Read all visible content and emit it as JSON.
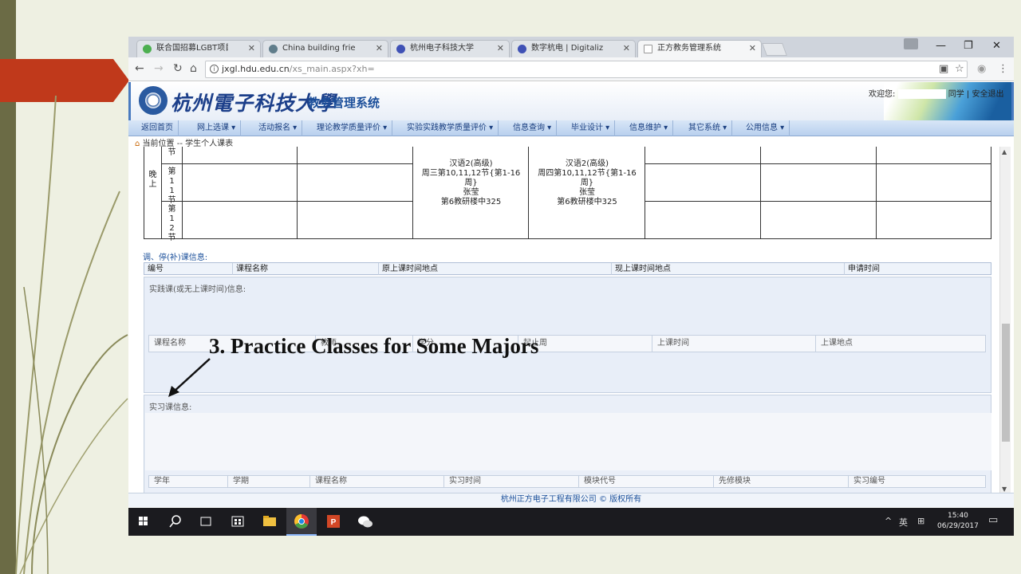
{
  "browser": {
    "tabs": [
      {
        "title": "联合国招募LGBT项目官员",
        "icon_color": "#4caf50"
      },
      {
        "title": "China building friendship",
        "icon_color": "#607d8b"
      },
      {
        "title": "杭州电子科技大学",
        "icon_color": "#3f51b5"
      },
      {
        "title": "数字杭电 | Digitalized DC",
        "icon_color": "#3f51b5"
      },
      {
        "title": "正方教务管理系统",
        "icon_color": "#9e9e9e"
      }
    ],
    "url_host": "jxgl.hdu.edu.cn",
    "url_path": "/xs_main.aspx?xh="
  },
  "site": {
    "school_name": "杭州電子科技大學",
    "system_name": "教务管理系统",
    "welcome_label": "欢迎您:",
    "welcome_suffix": "同学",
    "logout": "安全退出"
  },
  "menu": [
    "返回首页",
    "网上选课 ▾",
    "活动报名 ▾",
    "理论教学质量评价 ▾",
    "实验实践教学质量评价 ▾",
    "信息查询 ▾",
    "毕业设计 ▾",
    "信息维护 ▾",
    "其它系统 ▾",
    "公用信息 ▾"
  ],
  "breadcrumb": "当前位置 -- 学生个人课表",
  "timetable": {
    "period_label": "晚上",
    "rows": [
      "节",
      "第11节",
      "第12节"
    ],
    "courses": [
      {
        "name": "汉语2(高级)",
        "time": "周三第10,11,12节{第1-16周}",
        "teacher": "张莹",
        "room": "第6教研楼中325"
      },
      {
        "name": "汉语2(高级)",
        "time": "周四第10,11,12节{第1-16周}",
        "teacher": "张莹",
        "room": "第6教研楼中325"
      }
    ]
  },
  "adjustment": {
    "title": "调、停(补)课信息:",
    "headers": [
      "编号",
      "课程名称",
      "原上课时间地点",
      "现上课时间地点",
      "申请时间"
    ]
  },
  "practice": {
    "title": "实践课(或无上课时间)信息:",
    "headers": [
      "课程名称",
      "教师",
      "学分",
      "起止周",
      "上课时间",
      "上课地点"
    ]
  },
  "internship": {
    "title": "实习课信息:",
    "headers": [
      "学年",
      "学期",
      "课程名称",
      "实习时间",
      "模块代号",
      "先修模块",
      "实习编号"
    ]
  },
  "footer": "杭州正方电子工程有限公司 © 版权所有",
  "taskbar": {
    "tray_ime": "英",
    "time": "15:40",
    "date": "06/29/2017"
  },
  "annotation": "3. Practice Classes for Some Majors",
  "colors": {
    "slide_bg": "#eef0e2",
    "red_arrow": "#c0391b",
    "menu_text": "#1a3f80"
  }
}
